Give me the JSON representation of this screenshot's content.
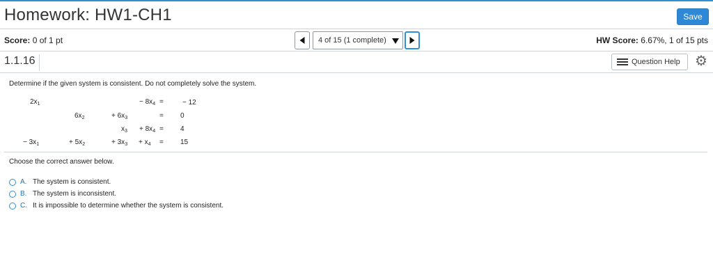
{
  "header": {
    "title": "Homework: HW1-CH1",
    "save_label": "Save"
  },
  "scorebar": {
    "score_label": "Score:",
    "score_value": "0 of 1 pt",
    "nav_select": "4 of 15 (1 complete)",
    "hw_score_label": "HW Score:",
    "hw_score_value": "6.67%, 1 of 15 pts"
  },
  "question": {
    "id": "1.1.16",
    "help_label": "Question Help",
    "prompt": "Determine if the given system is consistent. Do not completely solve the system.",
    "equations": {
      "r1": {
        "a": "2x",
        "a_sub": "1",
        "d": "− 8x",
        "d_sub": "4",
        "eq": "=",
        "rhs": "− 12"
      },
      "r2": {
        "b": "6x",
        "b_sub": "2",
        "c": "+ 6x",
        "c_sub": "3",
        "eq": "=",
        "rhs": "0"
      },
      "r3": {
        "c": "x",
        "c_sub": "3",
        "d": "+ 8x",
        "d_sub": "4",
        "eq": "=",
        "rhs": "4"
      },
      "r4": {
        "a": "− 3x",
        "a_sub": "1",
        "b": "+ 5x",
        "b_sub": "2",
        "c": "+ 3x",
        "c_sub": "3",
        "d": "+  x",
        "d_sub": "4",
        "eq": "=",
        "rhs": "15"
      }
    },
    "choose_text": "Choose the correct answer below.",
    "options": [
      {
        "letter": "A.",
        "text": "The system is consistent."
      },
      {
        "letter": "B.",
        "text": "The system is inconsistent."
      },
      {
        "letter": "C.",
        "text": "It is impossible to determine whether the system is consistent."
      }
    ]
  }
}
